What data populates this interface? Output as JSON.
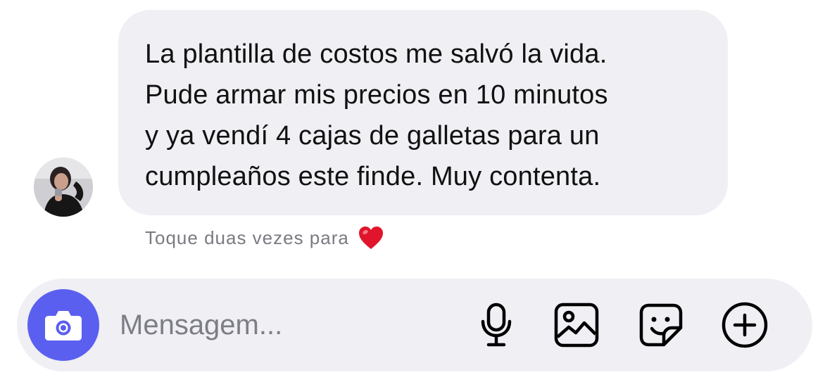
{
  "message": {
    "lines": [
      "La plantilla de costos me salvó la vida.",
      "Pude armar mis precios en 10 minutos",
      "y ya vendí 4 cajas de galletas para un",
      "cumpleaños este finde. Muy contenta."
    ]
  },
  "hint": {
    "text": "Toque duas vezes para"
  },
  "composer": {
    "placeholder": "Mensagem..."
  },
  "icons": {
    "avatar": "profile-photo",
    "heart": "red-heart-icon",
    "camera": "camera-icon",
    "mic": "microphone-icon",
    "gallery": "image-icon",
    "sticker": "sticker-icon",
    "add": "plus-circle-icon"
  },
  "colors": {
    "bubble": "#efeff4",
    "accent": "#5b5ff0",
    "heart": "#e0152b",
    "hint_text": "#7a7a82"
  }
}
